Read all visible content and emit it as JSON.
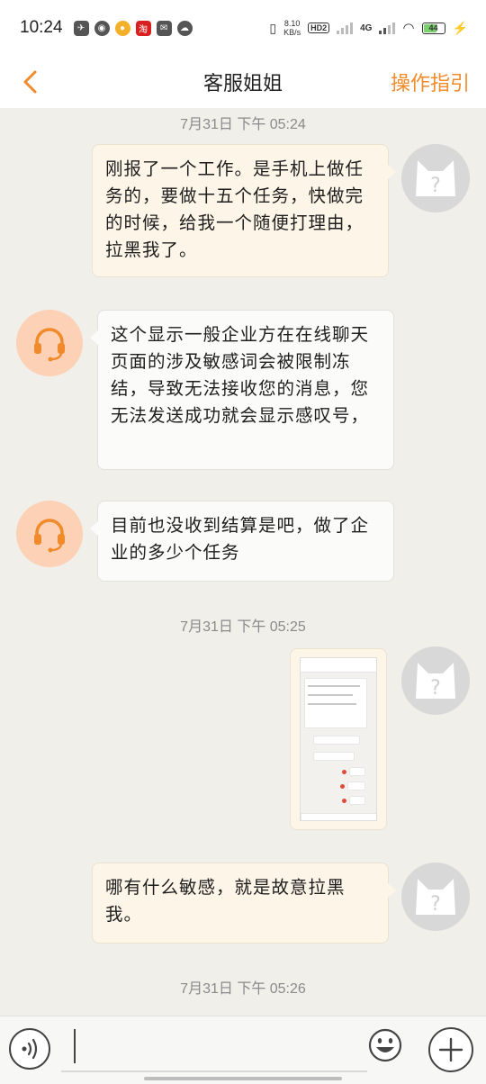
{
  "status_bar": {
    "time": "10:24",
    "net_speed_value": "8.10",
    "net_speed_unit": "KB/s",
    "hd_label": "HD2",
    "network_label": "4G",
    "battery_level": "44"
  },
  "header": {
    "title": "客服姐姐",
    "guide_label": "操作指引"
  },
  "messages": [
    {
      "type": "timestamp",
      "text": "7月31日 下午 05:24"
    },
    {
      "type": "user_text",
      "text": "刚报了一个工作。是手机上做任务的，要做十五个任务，快做完的时候，给我一个随便打理由，拉黑我了。"
    },
    {
      "type": "agent_text",
      "text": "这个显示一般企业方在在线聊天页面的涉及敏感词会被限制冻结，导致无法接收您的消息，您无法发送成功就会显示感叹号，"
    },
    {
      "type": "agent_text",
      "text": "目前也没收到结算是吧，做了企业的多少个任务"
    },
    {
      "type": "timestamp",
      "text": "7月31日 下午 05:25"
    },
    {
      "type": "user_image",
      "text": ""
    },
    {
      "type": "user_text",
      "text": "哪有什么敏感，就是故意拉黑我。"
    },
    {
      "type": "timestamp",
      "text": "7月31日 下午 05:26"
    }
  ],
  "colors": {
    "accent": "#f08a2a",
    "user_bubble": "#fdf6e8",
    "agent_bubble": "#fbfbf9",
    "agent_avatar": "#fcd1b6",
    "chat_background": "#f0efea"
  },
  "icons": {
    "back": "chevron-left-icon",
    "agent_avatar": "headset-icon",
    "user_avatar": "cat-question-icon",
    "voice": "voice-wave-icon",
    "emoji": "smiley-icon",
    "more": "plus-icon"
  }
}
